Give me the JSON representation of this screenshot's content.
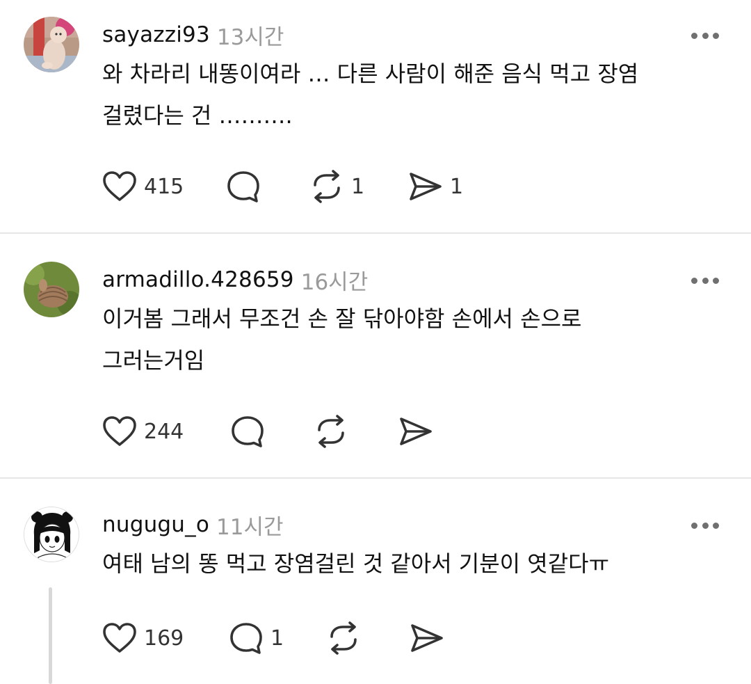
{
  "posts": [
    {
      "username": "sayazzi93",
      "time": "13시간",
      "lines": [
        "와 차라리 내똥이여라 … 다른 사람이 해준 음식 먹고 장염",
        "걸렸다는 건 ………."
      ],
      "likes": "415",
      "replies": "",
      "reposts": "1",
      "shares": "1",
      "avatar_icon": "doll-photo-avatar"
    },
    {
      "username": "armadillo.428659",
      "time": "16시간",
      "lines": [
        "이거봄 그래서 무조건 손 잘 닦아야함 손에서 손으로",
        "그러는거임"
      ],
      "likes": "244",
      "replies": "",
      "reposts": "",
      "shares": "",
      "avatar_icon": "armadillo-photo-avatar"
    },
    {
      "username": "nugugu_o",
      "time": "11시간",
      "lines": [
        "여태 남의 똥 먹고 장염걸린 것 같아서 기분이 엿같다ㅠ"
      ],
      "likes": "169",
      "replies": "1",
      "reposts": "",
      "shares": "",
      "avatar_icon": "anime-girl-avatar"
    }
  ],
  "icons": {
    "like": "heart-icon",
    "reply": "comment-bubble-icon",
    "repost": "repost-arrows-icon",
    "share": "send-icon",
    "more": "more-dots-icon"
  },
  "colors": {
    "text": "#111111",
    "muted": "#9a9a9a",
    "icon": "#333333",
    "divider": "#e6e6e6"
  }
}
